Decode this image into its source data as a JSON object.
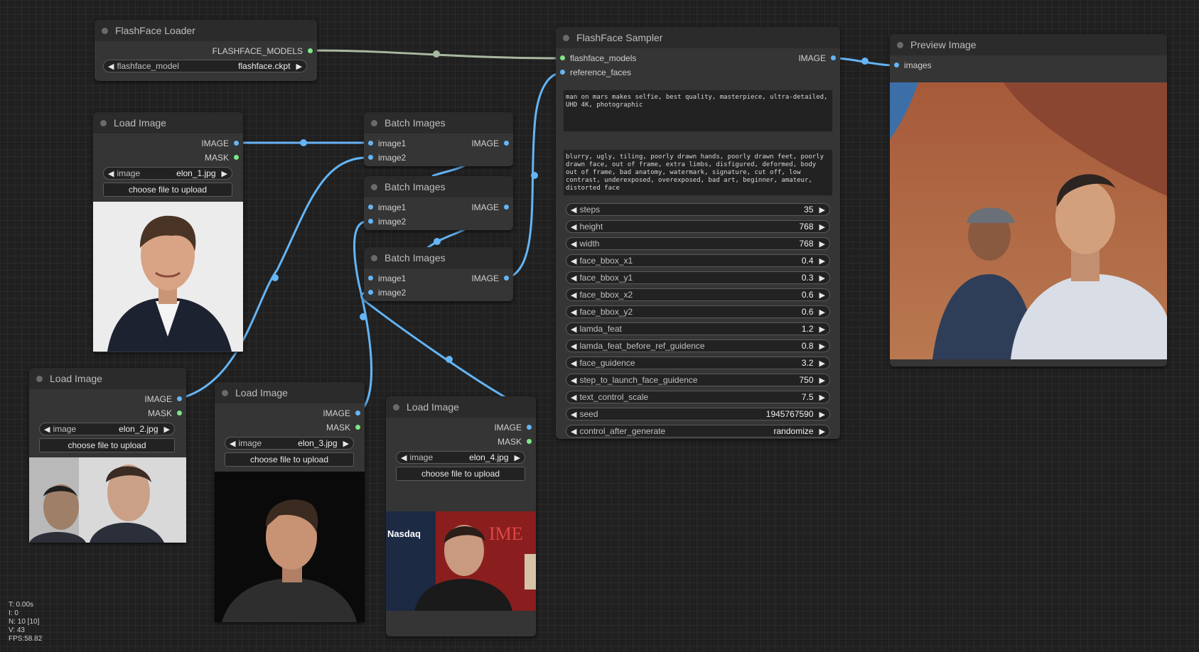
{
  "nodes": {
    "loader": {
      "title": "FlashFace Loader",
      "output": "FLASHFACE_MODELS",
      "widget_label": "flashface_model",
      "widget_value": "flashface.ckpt"
    },
    "load1": {
      "title": "Load Image",
      "out1": "IMAGE",
      "out2": "MASK",
      "widget_label": "image",
      "widget_value": "elon_1.jpg",
      "button": "choose file to upload"
    },
    "load2": {
      "title": "Load Image",
      "out1": "IMAGE",
      "out2": "MASK",
      "widget_label": "image",
      "widget_value": "elon_2.jpg",
      "button": "choose file to upload"
    },
    "load3": {
      "title": "Load Image",
      "out1": "IMAGE",
      "out2": "MASK",
      "widget_label": "image",
      "widget_value": "elon_3.jpg",
      "button": "choose file to upload"
    },
    "load4": {
      "title": "Load Image",
      "out1": "IMAGE",
      "out2": "MASK",
      "widget_label": "image",
      "widget_value": "elon_4.jpg",
      "button": "choose file to upload"
    },
    "batch1": {
      "title": "Batch Images",
      "in1": "image1",
      "in2": "image2",
      "out": "IMAGE"
    },
    "batch2": {
      "title": "Batch Images",
      "in1": "image1",
      "in2": "image2",
      "out": "IMAGE"
    },
    "batch3": {
      "title": "Batch Images",
      "in1": "image1",
      "in2": "image2",
      "out": "IMAGE"
    },
    "sampler": {
      "title": "FlashFace Sampler",
      "in1": "flashface_models",
      "in2": "reference_faces",
      "out": "IMAGE",
      "positive": "man on mars makes selfie, best quality, masterpiece, ultra-detailed, UHD 4K, photographic",
      "negative": "blurry, ugly, tiling, poorly drawn hands, poorly drawn feet, poorly drawn face, out of frame, extra limbs, disfigured, deformed, body out of frame, bad anatomy, watermark, signature, cut off, low contrast, underexposed, overexposed, bad art, beginner, amateur, distorted face",
      "params": [
        {
          "label": "steps",
          "value": "35"
        },
        {
          "label": "height",
          "value": "768"
        },
        {
          "label": "width",
          "value": "768"
        },
        {
          "label": "face_bbox_x1",
          "value": "0.4"
        },
        {
          "label": "face_bbox_y1",
          "value": "0.3"
        },
        {
          "label": "face_bbox_x2",
          "value": "0.6"
        },
        {
          "label": "face_bbox_y2",
          "value": "0.6"
        },
        {
          "label": "lamda_feat",
          "value": "1.2"
        },
        {
          "label": "lamda_feat_before_ref_guidence",
          "value": "0.8"
        },
        {
          "label": "face_guidence",
          "value": "3.2"
        },
        {
          "label": "step_to_launch_face_guidence",
          "value": "750"
        },
        {
          "label": "text_control_scale",
          "value": "7.5"
        },
        {
          "label": "seed",
          "value": "1945767590"
        },
        {
          "label": "control_after_generate",
          "value": "randomize"
        }
      ]
    },
    "preview": {
      "title": "Preview Image",
      "in": "images"
    }
  },
  "images": {
    "time_text": "IME",
    "nasdaq_text": "Nasdaq"
  },
  "stats": {
    "t": "T: 0.00s",
    "i": "I: 0",
    "n": "N: 10 [10]",
    "v": "V: 43",
    "fps": "FPS:58.82"
  },
  "colors": {
    "link_blue": "#64b5f6",
    "link_model": "#a8b8a0",
    "node_bg": "#353535",
    "title_bg": "#2b2b2b"
  }
}
